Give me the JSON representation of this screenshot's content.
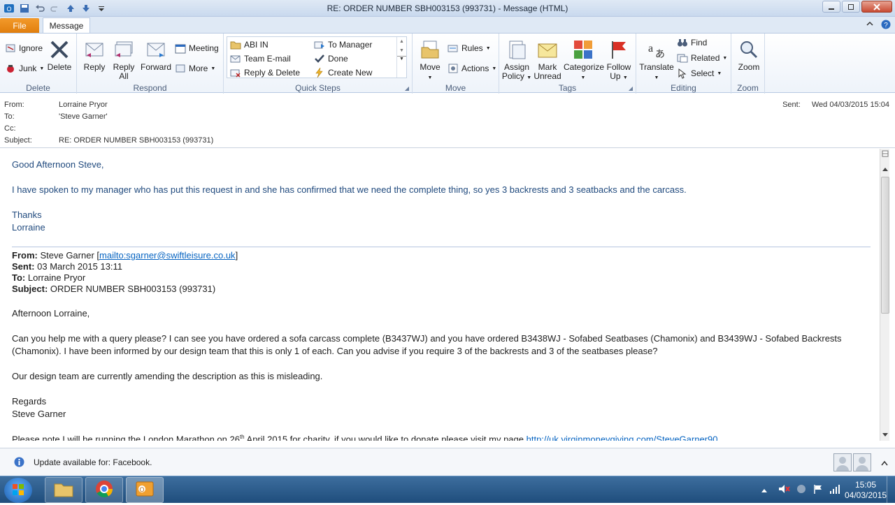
{
  "window": {
    "title": "RE: ORDER NUMBER SBH003153 (993731)  -  Message (HTML)"
  },
  "tabs": {
    "file": "File",
    "message": "Message"
  },
  "ribbon": {
    "delete_group": {
      "label": "Delete",
      "ignore": "Ignore",
      "junk": "Junk",
      "delete": "Delete"
    },
    "respond_group": {
      "label": "Respond",
      "reply": "Reply",
      "reply_all_1": "Reply",
      "reply_all_2": "All",
      "forward": "Forward",
      "meeting": "Meeting",
      "more": "More"
    },
    "quicksteps_group": {
      "label": "Quick Steps",
      "items": [
        "ABI IN",
        "To Manager",
        "Team E-mail",
        "Done",
        "Reply & Delete",
        "Create New"
      ]
    },
    "move_group": {
      "label": "Move",
      "move": "Move",
      "rules": "Rules",
      "actions": "Actions"
    },
    "tags_group": {
      "label": "Tags",
      "assign_1": "Assign",
      "assign_2": "Policy",
      "mark_1": "Mark",
      "mark_2": "Unread",
      "categorize": "Categorize",
      "follow_1": "Follow",
      "follow_2": "Up"
    },
    "editing_group": {
      "label": "Editing",
      "translate": "Translate",
      "find": "Find",
      "related": "Related",
      "select": "Select"
    },
    "zoom_group": {
      "label": "Zoom",
      "zoom": "Zoom"
    }
  },
  "header": {
    "from_label": "From:",
    "from_value": "Lorraine Pryor",
    "to_label": "To:",
    "to_value": "'Steve Garner'",
    "cc_label": "Cc:",
    "cc_value": "",
    "subject_label": "Subject:",
    "subject_value": "RE: ORDER NUMBER SBH003153 (993731)",
    "sent_label": "Sent:",
    "sent_value": "Wed 04/03/2015 15:04"
  },
  "body": {
    "greeting": "Good Afternoon Steve,",
    "line1": "I have spoken to my manager who has put this request in and she has confirmed that we need the complete thing, so yes 3 backrests and 3 seatbacks and the carcass.",
    "thanks": "Thanks",
    "signoff": "Lorraine",
    "quoted": {
      "from_label": "From:",
      "from_value": "Steve Garner [",
      "from_link": "mailto:sgarner@swiftleisure.co.uk",
      "from_close": "]",
      "sent_label": "Sent:",
      "sent_value": "03 March 2015 13:11",
      "to_label": "To:",
      "to_value": "Lorraine Pryor",
      "subject_label": "Subject:",
      "subject_value": "ORDER NUMBER SBH003153 (993731)",
      "greeting": "Afternoon Lorraine,",
      "para1_line1": "Can you help me with a query please? I can see you have ordered a sofa carcass complete (B3437WJ) and you have ordered B3438WJ - Sofabed Seatbases (Chamonix) and B3439WJ - Sofabed Backrests",
      "para1_line2": "(Chamonix). I have been informed by our design team that this is only 1 of each. Can you advise if you require 3 of the backrests and 3 of the seatbases please?",
      "para2": "Our design team are currently amending the description as this is misleading.",
      "regards": "Regards",
      "name": "Steve Garner",
      "note_a": "Please note I will be running the London Marathon on 26",
      "note_sup": "th",
      "note_b": " April 2015 for charity, if you would like to donate please visit my page ",
      "note_link": "http://uk.virginmoneygiving.com/SteveGarner90"
    }
  },
  "peoplebar": {
    "message": "Update available for: Facebook."
  },
  "taskbar": {
    "time": "15:05",
    "date": "04/03/2015"
  },
  "colors": {
    "accent_orange": "#e07d0c",
    "body_blue": "#1f497d",
    "link": "#0563c1"
  }
}
